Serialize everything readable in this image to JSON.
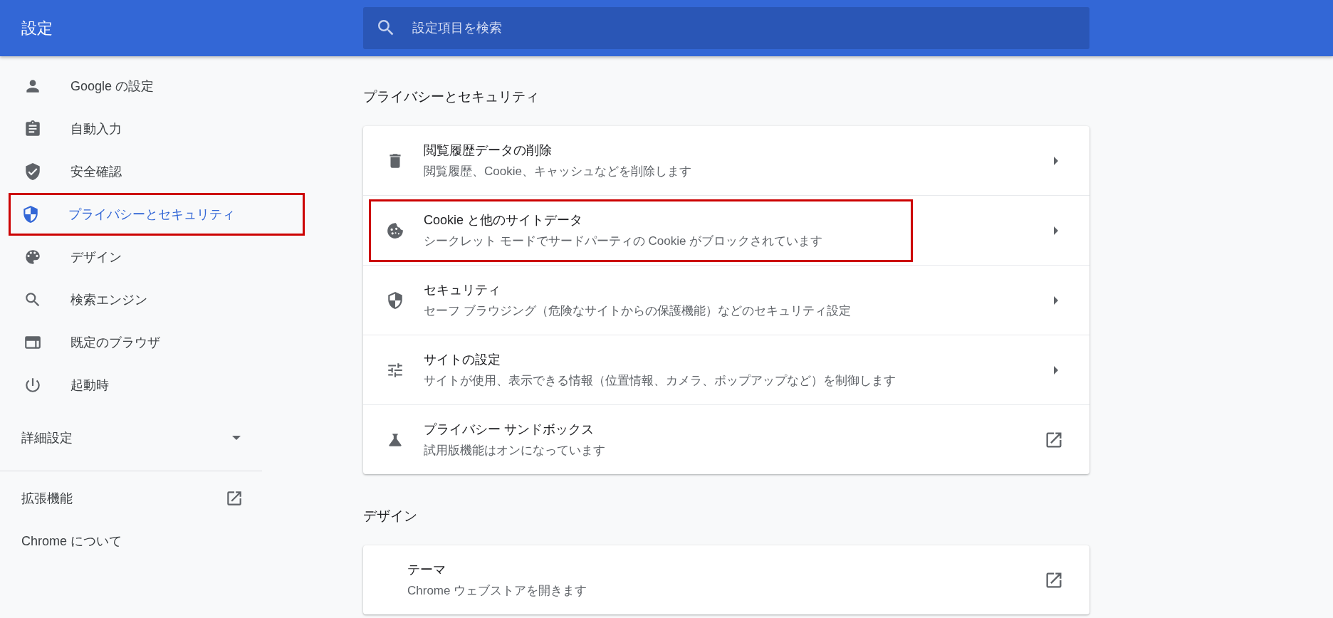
{
  "header": {
    "title": "設定",
    "search": {
      "placeholder": "設定項目を検索"
    }
  },
  "sidebar": {
    "items": [
      {
        "label": "Google の設定",
        "selected": false,
        "highlighted": false
      },
      {
        "label": "自動入力",
        "selected": false,
        "highlighted": false
      },
      {
        "label": "安全確認",
        "selected": false,
        "highlighted": false
      },
      {
        "label": "プライバシーとセキュリティ",
        "selected": true,
        "highlighted": true
      },
      {
        "label": "デザイン",
        "selected": false,
        "highlighted": false
      },
      {
        "label": "検索エンジン",
        "selected": false,
        "highlighted": false
      },
      {
        "label": "既定のブラウザ",
        "selected": false,
        "highlighted": false
      },
      {
        "label": "起動時",
        "selected": false,
        "highlighted": false
      }
    ],
    "advanced": {
      "label": "詳細設定",
      "expanded": false
    },
    "links": [
      {
        "label": "拡張機能",
        "kind": "external"
      },
      {
        "label": "Chrome について",
        "kind": "plain"
      }
    ]
  },
  "sections": [
    {
      "title": "プライバシーとセキュリティ",
      "rows": [
        {
          "title": "閲覧履歴データの削除",
          "subtitle": "閲覧履歴、Cookie、キャッシュなどを削除します",
          "kind": "submenu",
          "highlighted": false
        },
        {
          "title": "Cookie と他のサイトデータ",
          "subtitle": "シークレット モードでサードパーティの Cookie がブロックされています",
          "kind": "submenu",
          "highlighted": true
        },
        {
          "title": "セキュリティ",
          "subtitle": "セーフ ブラウジング（危険なサイトからの保護機能）などのセキュリティ設定",
          "kind": "submenu",
          "highlighted": false
        },
        {
          "title": "サイトの設定",
          "subtitle": "サイトが使用、表示できる情報（位置情報、カメラ、ポップアップなど）を制御します",
          "kind": "submenu",
          "highlighted": false
        },
        {
          "title": "プライバシー サンドボックス",
          "subtitle": "試用版機能はオンになっています",
          "kind": "external",
          "highlighted": false
        }
      ]
    },
    {
      "title": "デザイン",
      "rows": [
        {
          "title": "テーマ",
          "subtitle": "Chrome ウェブストアを開きます",
          "kind": "external",
          "highlighted": false
        }
      ]
    }
  ]
}
